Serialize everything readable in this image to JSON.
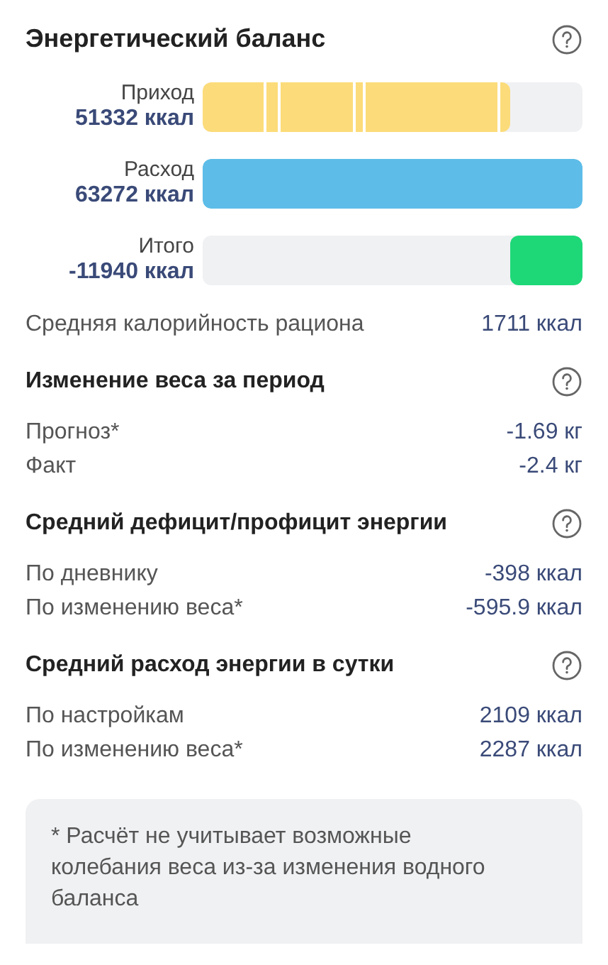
{
  "title": "Энергетический баланс",
  "bars": [
    {
      "kind": "income",
      "label": "Приход",
      "value": "51332 ккал",
      "color": "#fcdc7a"
    },
    {
      "kind": "expense",
      "label": "Расход",
      "value": "63272 ккал",
      "color": "#5dbde8",
      "level": 1
    },
    {
      "kind": "total",
      "label": "Итого",
      "value": "-11940 ккал",
      "color": "#1ed878",
      "level": 0.19
    }
  ],
  "average_row": {
    "label": "Средняя калорийность рациона",
    "value": "1711 ккал"
  },
  "sections": [
    {
      "title": "Изменение веса за период",
      "rows": [
        {
          "label": "Прогноз*",
          "value": "-1.69 кг"
        },
        {
          "label": "Факт",
          "value": "-2.4 кг"
        }
      ]
    },
    {
      "title": "Средний дефицит/профицит энергии",
      "rows": [
        {
          "label": "По дневнику",
          "value": "-398 ккал"
        },
        {
          "label": "По изменению веса*",
          "value": "-595.9 ккал"
        }
      ]
    },
    {
      "title": "Средний расход энергии в сутки",
      "rows": [
        {
          "label": "По настройкам",
          "value": "2109 ккал"
        },
        {
          "label": "По изменению веса*",
          "value": "2287 ккал"
        }
      ]
    }
  ],
  "note": "* Расчёт не учитывает возможные колебания веса из-за изменения водного баланса"
}
